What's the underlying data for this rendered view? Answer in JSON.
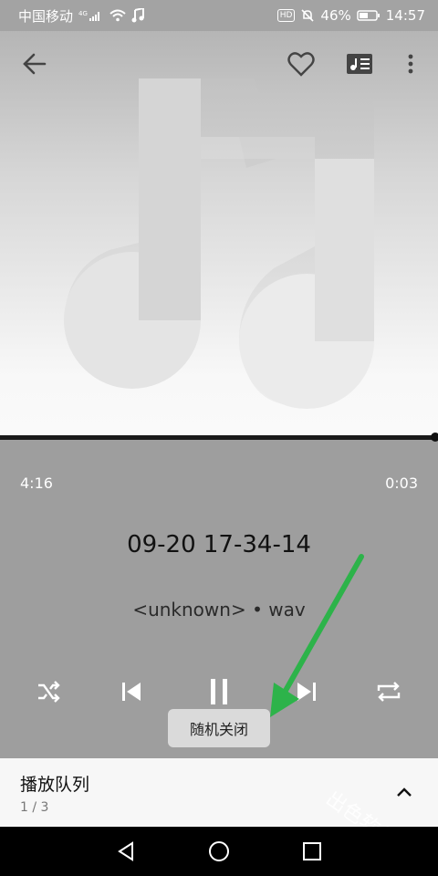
{
  "status_bar": {
    "carrier": "中国移动",
    "network": "4G",
    "battery_percent": "46%",
    "time": "14:57",
    "hd_label": "HD"
  },
  "player": {
    "elapsed_left": "4:16",
    "elapsed_right": "0:03",
    "track_title": "09-20 17-34-14",
    "track_meta": "<unknown> • wav",
    "progress_fraction": 1.0,
    "toast": "随机关闭"
  },
  "queue": {
    "title": "播放队列",
    "count": "1 / 3"
  },
  "watermark": "出色软件站",
  "colors": {
    "control_bg": "#9e9e9e",
    "annotation_arrow": "#2db34a"
  }
}
